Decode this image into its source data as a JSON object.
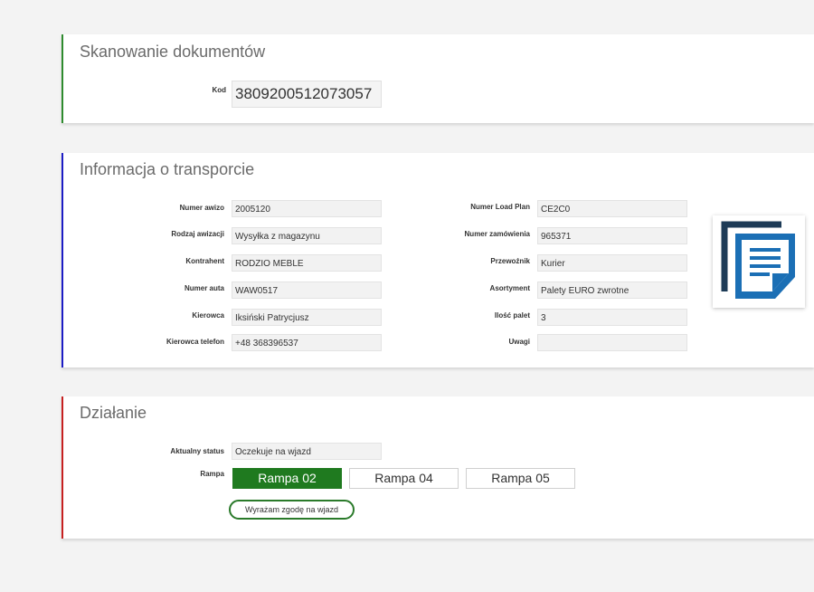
{
  "scan": {
    "title": "Skanowanie dokumentów",
    "code_label": "Kod",
    "code_value": "3809200512073057"
  },
  "transport": {
    "title": "Informacja o transporcie",
    "left": [
      {
        "label": "Numer awizo",
        "value": "2005120"
      },
      {
        "label": "Rodzaj awizacji",
        "value": "Wysyłka z magazynu"
      },
      {
        "label": "Kontrahent",
        "value": "RODZIO MEBLE"
      },
      {
        "label": "Numer auta",
        "value": "WAW0517"
      },
      {
        "label": "Kierowca",
        "value": "Iksiński Patrycjusz"
      },
      {
        "label": "Kierowca telefon",
        "value": "+48 368396537"
      }
    ],
    "right": [
      {
        "label": "Numer Load Plan",
        "value": "CE2C0"
      },
      {
        "label": "Numer zamówienia",
        "value": "965371"
      },
      {
        "label": "Przewoźnik",
        "value": "Kurier"
      },
      {
        "label": "Asortyment",
        "value": "Palety EURO zwrotne"
      },
      {
        "label": "Ilość palet",
        "value": "3"
      },
      {
        "label": "Uwagi",
        "value": ""
      }
    ],
    "document_icon": "document-icon"
  },
  "action": {
    "title": "Działanie",
    "status_label": "Aktualny status",
    "status_value": "Oczekuje na wjazd",
    "ramp_label": "Rampa",
    "ramps": [
      {
        "label": "Rampa 02",
        "selected": true
      },
      {
        "label": "Rampa 04",
        "selected": false
      },
      {
        "label": "Rampa 05",
        "selected": false
      }
    ],
    "consent_label": "Wyrażam zgodę na wjazd"
  },
  "colors": {
    "scan_accent": "#2e8b2e",
    "transport_accent": "#1c1cc4",
    "action_accent": "#c62020",
    "selected_ramp": "#1f7a1f",
    "icon_dark": "#1d3b57",
    "icon_blue": "#1b6fb5"
  }
}
